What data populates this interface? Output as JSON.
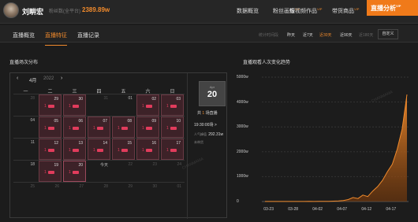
{
  "user": {
    "name": "刘畊宏",
    "fans_label": "粉丝数(全平台)",
    "fans_value": "2389.89w"
  },
  "nav": {
    "items": [
      {
        "label": "数据概览",
        "vip": ""
      },
      {
        "label": "粉丝画像",
        "vip": "VIP"
      },
      {
        "label": "短视频作品",
        "vip": "VIP"
      },
      {
        "label": "带货商品",
        "vip": "VIP"
      }
    ],
    "active": {
      "label": "直播分析",
      "vip": "VIP"
    }
  },
  "tabs": [
    "直播概览",
    "直播特征",
    "直播记录"
  ],
  "active_tab": 1,
  "ranges": {
    "label": "统计时间段",
    "items": [
      "昨天",
      "近7天",
      "近30天",
      "近90天",
      "近180天"
    ],
    "active": 2,
    "dim": [
      4
    ],
    "custom": "自定义"
  },
  "calendar": {
    "title": "直播场次分布",
    "month": "4月",
    "year": "2022",
    "weekdays": [
      "一",
      "二",
      "三",
      "四",
      "五",
      "六",
      "日"
    ],
    "rows": [
      [
        {
          "d": "28",
          "dim": true
        },
        {
          "d": "29",
          "dim": true,
          "live": 1
        },
        {
          "d": "30",
          "dim": true,
          "live": 1
        },
        {
          "d": "31",
          "dim": true
        },
        {
          "d": "01"
        },
        {
          "d": "02",
          "live": 1
        },
        {
          "d": "03",
          "live": 1
        }
      ],
      [
        {
          "d": "04"
        },
        {
          "d": "05",
          "live": 1
        },
        {
          "d": "06",
          "live": 1
        },
        {
          "d": "07",
          "live": 1
        },
        {
          "d": "08",
          "live": 1
        },
        {
          "d": "09",
          "live": 1
        },
        {
          "d": "10",
          "live": 1
        }
      ],
      [
        {
          "d": "11"
        },
        {
          "d": "12",
          "live": 1
        },
        {
          "d": "13",
          "live": 1
        },
        {
          "d": "14",
          "live": 1
        },
        {
          "d": "15",
          "live": 1
        },
        {
          "d": "16",
          "live": 1
        },
        {
          "d": "17",
          "live": 1
        }
      ],
      [
        {
          "d": "18"
        },
        {
          "d": "19",
          "live": 1
        },
        {
          "d": "20",
          "live": 1,
          "hl": true
        },
        {
          "d": "今天"
        },
        {
          "d": "22",
          "dim": true
        },
        {
          "d": "23",
          "dim": true
        },
        {
          "d": "24",
          "dim": true
        }
      ],
      [
        {
          "d": "25",
          "dim": true
        },
        {
          "d": "26",
          "dim": true
        },
        {
          "d": "27",
          "dim": true
        },
        {
          "d": "28",
          "dim": true
        },
        {
          "d": "29",
          "dim": true
        },
        {
          "d": "30",
          "dim": true
        },
        {
          "d": "01",
          "dim": true
        }
      ]
    ]
  },
  "day_info": {
    "month": "Apr",
    "day": "20",
    "total_prefix": "共",
    "total_count": "1",
    "total_suffix": "场直播",
    "time": "19:30:00场 >",
    "peak_label": "人气峰值",
    "peak_value": "292.31w",
    "sale_label": "未带货"
  },
  "chart_data": {
    "type": "area",
    "title": "直播观看人次变化趋势",
    "color": "#f08a2c",
    "ylim": [
      0,
      5000
    ],
    "y_ticks": [
      "5000w",
      "4000w",
      "3000w",
      "2000w",
      "1000w",
      "0"
    ],
    "x_ticks": [
      "03-23",
      "03-28",
      "04-02",
      "04-07",
      "04-12",
      "04-17"
    ],
    "x": [
      "03-22",
      "03-23",
      "03-24",
      "03-25",
      "03-26",
      "03-27",
      "03-28",
      "03-29",
      "03-30",
      "03-31",
      "04-01",
      "04-02",
      "04-03",
      "04-04",
      "04-05",
      "04-06",
      "04-07",
      "04-08",
      "04-09",
      "04-10",
      "04-11",
      "04-12",
      "04-13",
      "04-14",
      "04-15",
      "04-16",
      "04-17",
      "04-18",
      "04-19",
      "04-20"
    ],
    "values": [
      2,
      3,
      2,
      3,
      2,
      3,
      2,
      4,
      3,
      5,
      3,
      5,
      8,
      10,
      15,
      25,
      40,
      80,
      160,
      120,
      260,
      200,
      420,
      600,
      850,
      1200,
      1500,
      2100,
      2900,
      4300
    ]
  }
}
